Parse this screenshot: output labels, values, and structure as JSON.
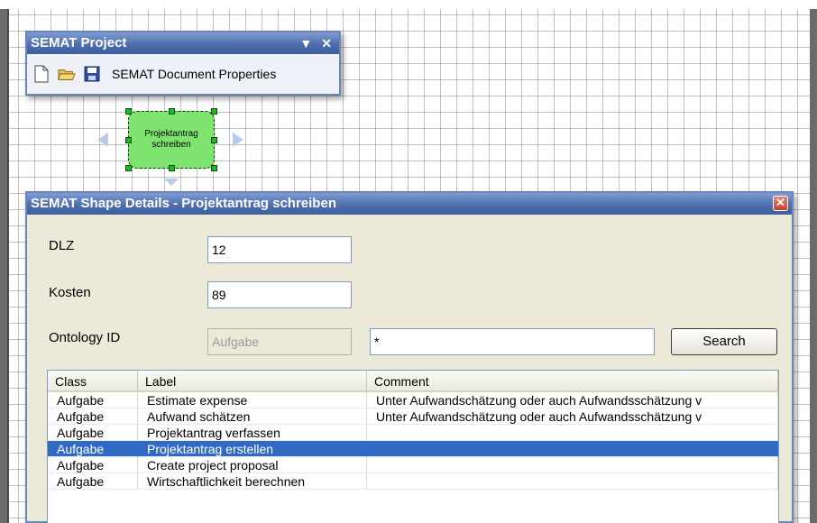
{
  "project_panel": {
    "title": "SEMAT Project",
    "dropdown_glyph": "▼",
    "close_glyph": "✕",
    "document_properties_label": "SEMAT Document Properties",
    "icons": [
      "new-document-icon",
      "open-folder-icon",
      "save-disk-icon"
    ]
  },
  "shape": {
    "label_line1": "Projektantrag",
    "label_line2": "schreiben",
    "fill_color": "#7ee36f"
  },
  "details_dialog": {
    "title": "SEMAT Shape Details - Projektantrag schreiben",
    "close_glyph": "✕",
    "dlz_label": "DLZ",
    "dlz_value": "12",
    "kosten_label": "Kosten",
    "kosten_value": "89",
    "ontology_label": "Ontology ID",
    "ontology_value": "Aufgabe",
    "search_value": "*",
    "search_button": "Search",
    "columns": [
      "Class",
      "Label",
      "Comment"
    ],
    "rows": [
      {
        "class": "Aufgabe",
        "label": "Estimate expense",
        "comment": "Unter Aufwandschätzung oder auch Aufwandsschätzung v",
        "selected": false
      },
      {
        "class": "Aufgabe",
        "label": "Aufwand schätzen",
        "comment": "Unter Aufwandschätzung oder auch Aufwandsschätzung v",
        "selected": false
      },
      {
        "class": "Aufgabe",
        "label": "Projektantrag verfassen",
        "comment": "",
        "selected": false
      },
      {
        "class": "Aufgabe",
        "label": "Projektantrag erstellen",
        "comment": "",
        "selected": true
      },
      {
        "class": "Aufgabe",
        "label": "Create project proposal",
        "comment": "",
        "selected": false
      },
      {
        "class": "Aufgabe",
        "label": "Wirtschaftlichkeit berechnen",
        "comment": "",
        "selected": false
      }
    ]
  },
  "colors": {
    "titlebar": "#4f6fae",
    "selection": "#316ac5",
    "dialog_bg": "#ece9d8"
  }
}
